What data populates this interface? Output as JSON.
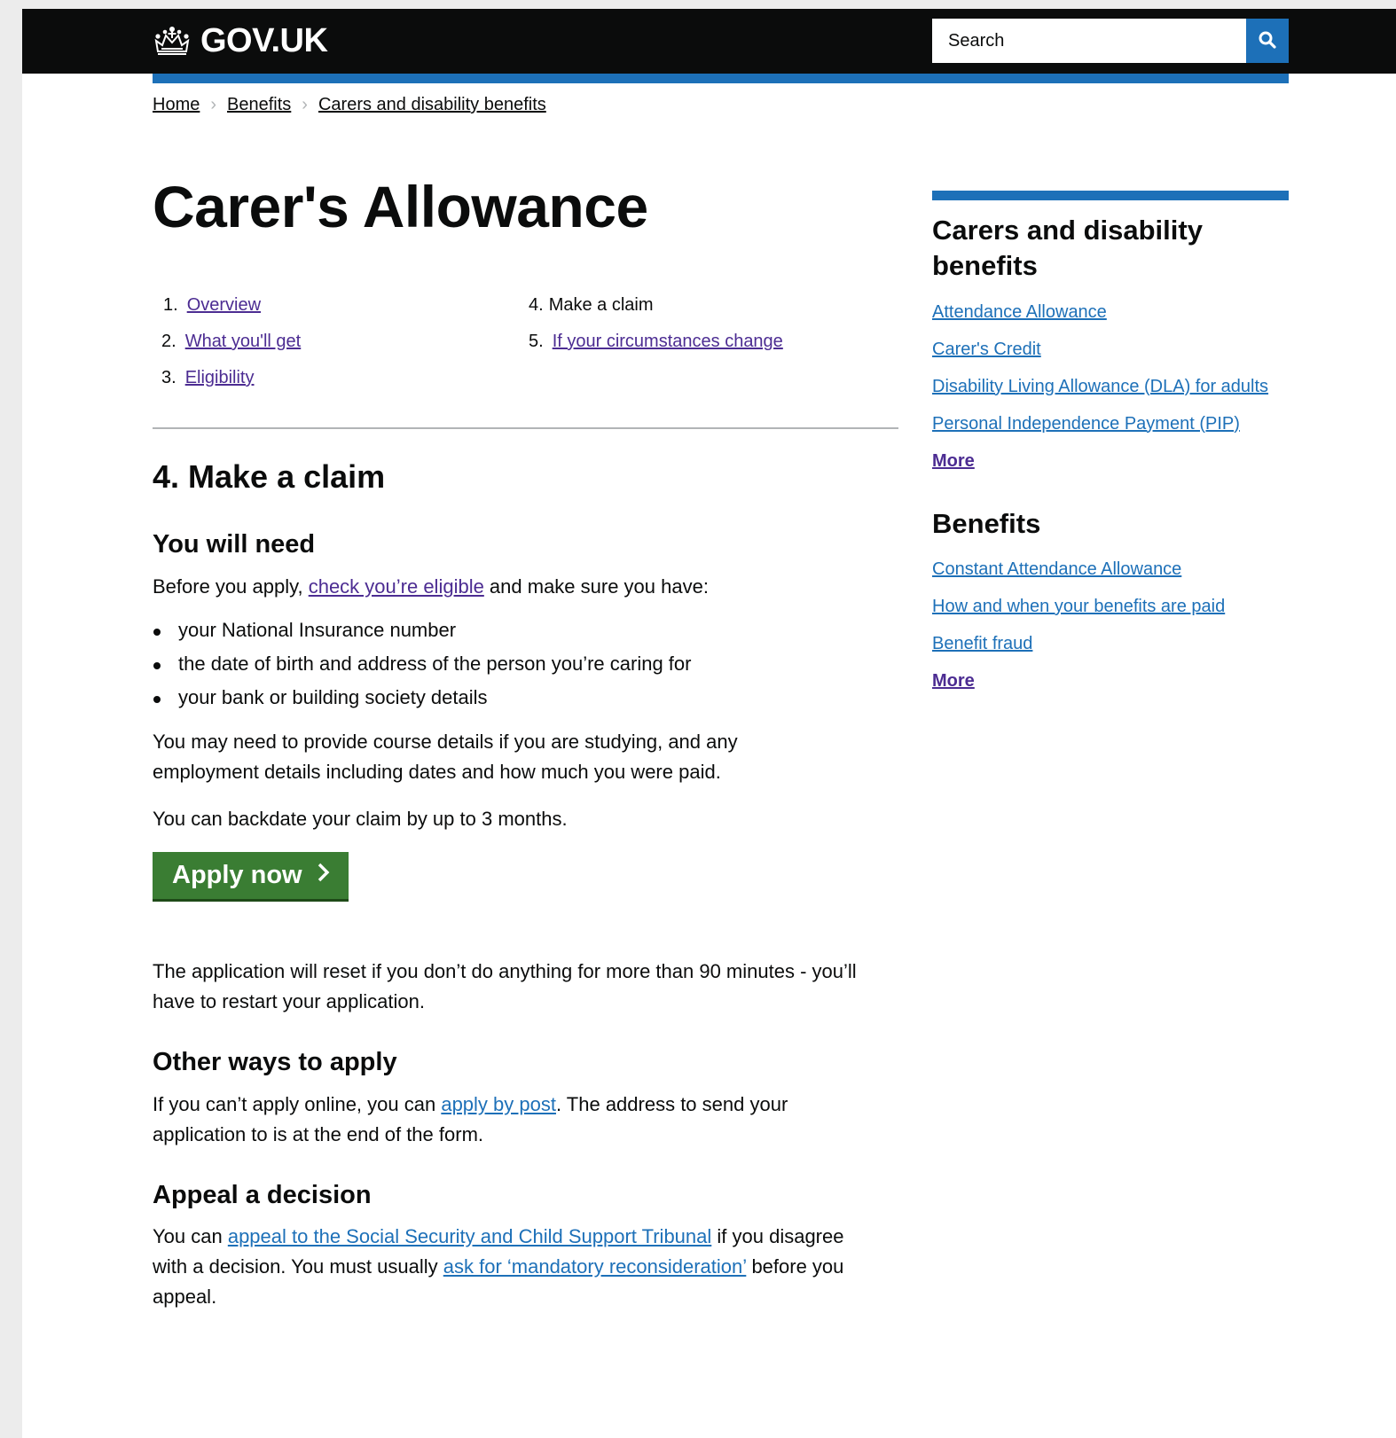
{
  "header": {
    "logo_text": "GOV.UK",
    "logo_icon": "crown-icon",
    "search_placeholder": "Search",
    "search_icon": "search-icon",
    "colors": {
      "header_bg": "#0b0c0c",
      "accent": "#1d70b8"
    }
  },
  "breadcrumb": [
    {
      "label": "Home"
    },
    {
      "label": "Benefits"
    },
    {
      "label": "Carers and disability benefits"
    }
  ],
  "page_title": "Carer's Allowance",
  "contents": [
    {
      "num": "1.",
      "label": "Overview",
      "link": true
    },
    {
      "num": "2.",
      "label": "What you'll get",
      "link": true
    },
    {
      "num": "3.",
      "label": "Eligibility",
      "link": true
    },
    {
      "num": "4.",
      "label": "Make a claim",
      "link": false
    },
    {
      "num": "5.",
      "label": "If your circumstances change",
      "link": true
    }
  ],
  "section": {
    "title": "4. Make a claim",
    "you_will_need": {
      "heading": "You will need",
      "intro_before": "Before you apply, ",
      "intro_link": "check you’re eligible",
      "intro_after": " and make sure you have:",
      "bullets": [
        "your National Insurance number",
        "the date of birth and address of the person you’re caring for",
        "your bank or building society details"
      ],
      "course_details": "You may need to provide course details if you are studying, and any employment details including dates and how much you were paid.",
      "backdate": "You can backdate your claim by up to 3 months."
    },
    "apply_button": {
      "label": "Apply now",
      "color": "#3a7d33"
    },
    "reset_notice": "The application will reset if you don’t do anything for more than 90 minutes - you’ll have to restart your application.",
    "other_ways": {
      "heading": "Other ways to apply",
      "text_before": "If you can’t apply online, you can ",
      "link": "apply by post",
      "text_after": ". The address to send your application to is at the end of the form."
    },
    "appeal": {
      "heading": "Appeal a decision",
      "text_1": "You can ",
      "link_1": "appeal to the Social Security and Child Support Tribunal",
      "text_2": " if you disagree with a decision. You must usually ",
      "link_2": "ask for ‘mandatory reconsideration’",
      "text_3": " before you appeal."
    }
  },
  "sidebar": {
    "groups": [
      {
        "heading": "Carers and disability benefits",
        "links": [
          "Attendance Allowance",
          "Carer's Credit",
          "Disability Living Allowance (DLA) for adults",
          "Personal Independence Payment (PIP)"
        ],
        "more": "More"
      },
      {
        "heading": "Benefits",
        "links": [
          "Constant Attendance Allowance",
          "How and when your benefits are paid",
          "Benefit fraud"
        ],
        "more": "More"
      }
    ]
  }
}
